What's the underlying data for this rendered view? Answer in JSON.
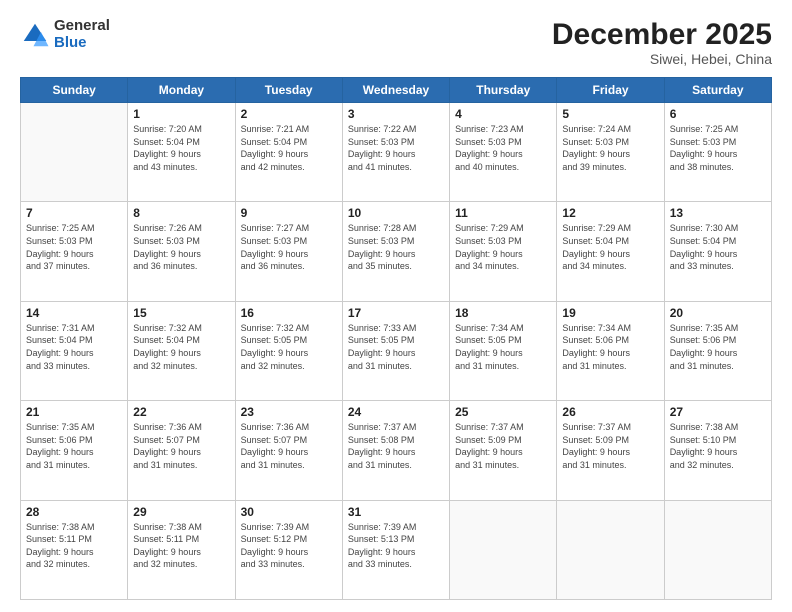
{
  "header": {
    "logo_general": "General",
    "logo_blue": "Blue",
    "month": "December 2025",
    "location": "Siwei, Hebei, China"
  },
  "days_of_week": [
    "Sunday",
    "Monday",
    "Tuesday",
    "Wednesday",
    "Thursday",
    "Friday",
    "Saturday"
  ],
  "weeks": [
    [
      {
        "num": "",
        "info": ""
      },
      {
        "num": "1",
        "info": "Sunrise: 7:20 AM\nSunset: 5:04 PM\nDaylight: 9 hours\nand 43 minutes."
      },
      {
        "num": "2",
        "info": "Sunrise: 7:21 AM\nSunset: 5:04 PM\nDaylight: 9 hours\nand 42 minutes."
      },
      {
        "num": "3",
        "info": "Sunrise: 7:22 AM\nSunset: 5:03 PM\nDaylight: 9 hours\nand 41 minutes."
      },
      {
        "num": "4",
        "info": "Sunrise: 7:23 AM\nSunset: 5:03 PM\nDaylight: 9 hours\nand 40 minutes."
      },
      {
        "num": "5",
        "info": "Sunrise: 7:24 AM\nSunset: 5:03 PM\nDaylight: 9 hours\nand 39 minutes."
      },
      {
        "num": "6",
        "info": "Sunrise: 7:25 AM\nSunset: 5:03 PM\nDaylight: 9 hours\nand 38 minutes."
      }
    ],
    [
      {
        "num": "7",
        "info": "Sunrise: 7:25 AM\nSunset: 5:03 PM\nDaylight: 9 hours\nand 37 minutes."
      },
      {
        "num": "8",
        "info": "Sunrise: 7:26 AM\nSunset: 5:03 PM\nDaylight: 9 hours\nand 36 minutes."
      },
      {
        "num": "9",
        "info": "Sunrise: 7:27 AM\nSunset: 5:03 PM\nDaylight: 9 hours\nand 36 minutes."
      },
      {
        "num": "10",
        "info": "Sunrise: 7:28 AM\nSunset: 5:03 PM\nDaylight: 9 hours\nand 35 minutes."
      },
      {
        "num": "11",
        "info": "Sunrise: 7:29 AM\nSunset: 5:03 PM\nDaylight: 9 hours\nand 34 minutes."
      },
      {
        "num": "12",
        "info": "Sunrise: 7:29 AM\nSunset: 5:04 PM\nDaylight: 9 hours\nand 34 minutes."
      },
      {
        "num": "13",
        "info": "Sunrise: 7:30 AM\nSunset: 5:04 PM\nDaylight: 9 hours\nand 33 minutes."
      }
    ],
    [
      {
        "num": "14",
        "info": "Sunrise: 7:31 AM\nSunset: 5:04 PM\nDaylight: 9 hours\nand 33 minutes."
      },
      {
        "num": "15",
        "info": "Sunrise: 7:32 AM\nSunset: 5:04 PM\nDaylight: 9 hours\nand 32 minutes."
      },
      {
        "num": "16",
        "info": "Sunrise: 7:32 AM\nSunset: 5:05 PM\nDaylight: 9 hours\nand 32 minutes."
      },
      {
        "num": "17",
        "info": "Sunrise: 7:33 AM\nSunset: 5:05 PM\nDaylight: 9 hours\nand 31 minutes."
      },
      {
        "num": "18",
        "info": "Sunrise: 7:34 AM\nSunset: 5:05 PM\nDaylight: 9 hours\nand 31 minutes."
      },
      {
        "num": "19",
        "info": "Sunrise: 7:34 AM\nSunset: 5:06 PM\nDaylight: 9 hours\nand 31 minutes."
      },
      {
        "num": "20",
        "info": "Sunrise: 7:35 AM\nSunset: 5:06 PM\nDaylight: 9 hours\nand 31 minutes."
      }
    ],
    [
      {
        "num": "21",
        "info": "Sunrise: 7:35 AM\nSunset: 5:06 PM\nDaylight: 9 hours\nand 31 minutes."
      },
      {
        "num": "22",
        "info": "Sunrise: 7:36 AM\nSunset: 5:07 PM\nDaylight: 9 hours\nand 31 minutes."
      },
      {
        "num": "23",
        "info": "Sunrise: 7:36 AM\nSunset: 5:07 PM\nDaylight: 9 hours\nand 31 minutes."
      },
      {
        "num": "24",
        "info": "Sunrise: 7:37 AM\nSunset: 5:08 PM\nDaylight: 9 hours\nand 31 minutes."
      },
      {
        "num": "25",
        "info": "Sunrise: 7:37 AM\nSunset: 5:09 PM\nDaylight: 9 hours\nand 31 minutes."
      },
      {
        "num": "26",
        "info": "Sunrise: 7:37 AM\nSunset: 5:09 PM\nDaylight: 9 hours\nand 31 minutes."
      },
      {
        "num": "27",
        "info": "Sunrise: 7:38 AM\nSunset: 5:10 PM\nDaylight: 9 hours\nand 32 minutes."
      }
    ],
    [
      {
        "num": "28",
        "info": "Sunrise: 7:38 AM\nSunset: 5:11 PM\nDaylight: 9 hours\nand 32 minutes."
      },
      {
        "num": "29",
        "info": "Sunrise: 7:38 AM\nSunset: 5:11 PM\nDaylight: 9 hours\nand 32 minutes."
      },
      {
        "num": "30",
        "info": "Sunrise: 7:39 AM\nSunset: 5:12 PM\nDaylight: 9 hours\nand 33 minutes."
      },
      {
        "num": "31",
        "info": "Sunrise: 7:39 AM\nSunset: 5:13 PM\nDaylight: 9 hours\nand 33 minutes."
      },
      {
        "num": "",
        "info": ""
      },
      {
        "num": "",
        "info": ""
      },
      {
        "num": "",
        "info": ""
      }
    ]
  ]
}
